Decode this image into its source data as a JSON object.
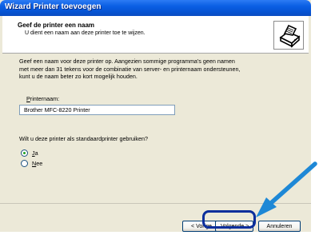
{
  "window": {
    "title": "Wizard Printer toevoegen"
  },
  "header": {
    "title": "Geef de printer een naam",
    "subtitle": "U dient een naam aan deze printer toe te wijzen.",
    "icon": "printer-icon"
  },
  "content": {
    "intro_lines": [
      "Geef een naam voor deze printer op. Aangezien sommige programma's geen namen",
      "met meer dan 31 tekens voor de combinatie van server- en printernaam ondersteunen,",
      "kunt u de naam beter zo kort mogelijk houden."
    ],
    "printer_name_label": "Printernaam:",
    "printer_name_label_first": "P",
    "printer_name_label_rest": "rinternaam:",
    "printer_name_value": "Brother MFC-8220 Printer",
    "default_question": "Wilt u deze printer als standaardprinter gebruiken?",
    "options": [
      {
        "label": "Ja",
        "accel": "J",
        "rest": "a",
        "checked": true
      },
      {
        "label": "Nee",
        "accel": "N",
        "rest": "ee",
        "checked": false
      }
    ]
  },
  "footer": {
    "back_label": "< Vorige",
    "next_label": "Volgende >",
    "cancel_label": "Annuleren"
  },
  "colors": {
    "titlebar": "#0a5ee3",
    "highlight": "#0a2e9c",
    "arrow": "#1e88d6"
  }
}
